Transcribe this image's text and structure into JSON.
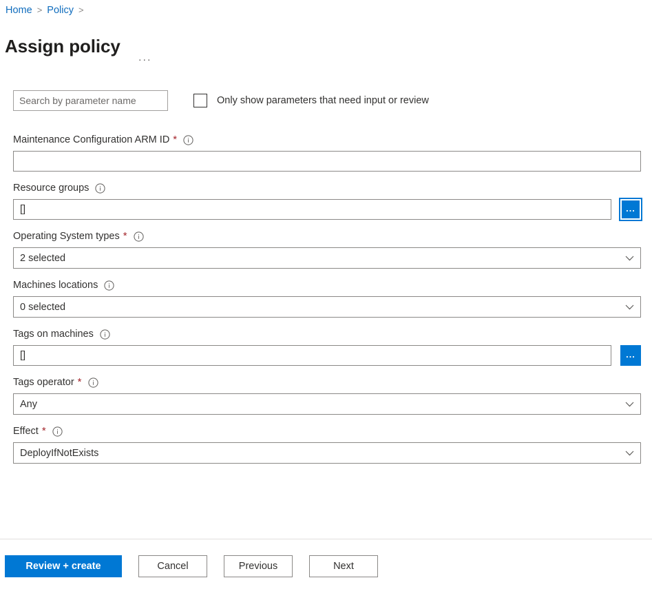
{
  "breadcrumb": {
    "items": [
      {
        "label": "Home",
        "separator": ">"
      },
      {
        "label": "Policy",
        "separator": ">"
      }
    ]
  },
  "header": {
    "title": "Assign policy",
    "more_menu": "···"
  },
  "filters": {
    "search_placeholder": "Search by parameter name",
    "search_value": "",
    "checkbox_label": "Only show parameters that need input or review",
    "checkbox_checked": false
  },
  "parameters": [
    {
      "label": "Maintenance Configuration ARM ID",
      "required": true,
      "info": "i",
      "control": "text",
      "value": "",
      "browse": false
    },
    {
      "label": "Resource groups",
      "required": false,
      "info": "i",
      "control": "text",
      "value": "[]",
      "browse": true,
      "browse_label": "...",
      "browse_focused": true
    },
    {
      "label": "Operating System types",
      "required": true,
      "info": "i",
      "control": "select",
      "value": "2 selected"
    },
    {
      "label": "Machines locations",
      "required": false,
      "info": "i",
      "control": "select",
      "value": "0 selected"
    },
    {
      "label": "Tags on machines",
      "required": false,
      "info": "i",
      "control": "text",
      "value": "[]",
      "browse": true,
      "browse_label": "...",
      "browse_focused": false
    },
    {
      "label": "Tags operator",
      "required": true,
      "info": "i",
      "control": "select",
      "value": "Any"
    },
    {
      "label": "Effect",
      "required": true,
      "info": "i",
      "control": "select",
      "value": "DeployIfNotExists"
    }
  ],
  "footer": {
    "review_create": "Review + create",
    "cancel": "Cancel",
    "previous": "Previous",
    "next": "Next"
  },
  "colors": {
    "accent": "#0078d4",
    "link": "#0f6cbd",
    "required": "#a4262c",
    "border": "#8a8886",
    "text": "#323130"
  },
  "icons": {
    "info": "info-icon",
    "chevron": "chevron-down-icon",
    "browse": "ellipsis-icon"
  }
}
